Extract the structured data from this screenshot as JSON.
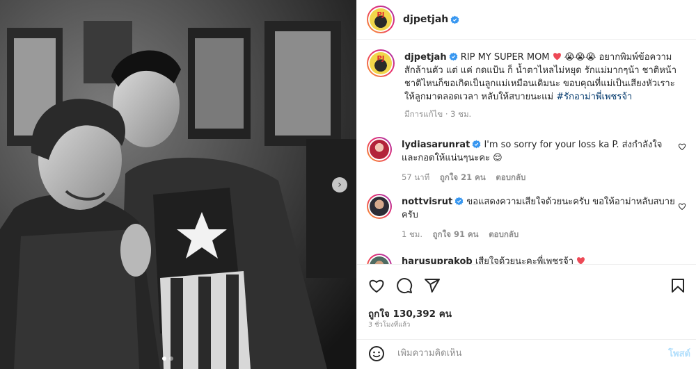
{
  "post": {
    "author": "djpetjah",
    "caption_parts": [
      "RIP MY SUPER MOM",
      "😭😭😭 อยากพิมพ์ข้อความสักล้านตัว แต่ แค่ กดแป้น ก็ น้ำตาไหลไม่หยุด รักแม่มากๆน้า ชาติหน้าชาติไหนก็ขอเกิดเป็นลูกแม่เหมือนเดิมนะ ขอบคุณที่แม่เป็นเสียงหัวเราะให้ลูกมาตลอดเวลา หลับให้สบายนะแม่"
    ],
    "hashtag": "#รักอาม่าพี่เพชรจ้า",
    "caption_meta": "มีการแก้ไข · 3 ชม."
  },
  "comments": [
    {
      "username": "lydiasarunrat",
      "text": "I'm so sorry for your loss ka P. ส่งกำลังใจและกอดให้แน่นๆนะคะ 😌",
      "time": "57 นาที",
      "likes": "ถูกใจ 21 คน",
      "reply": "ตอบกลับ"
    },
    {
      "username": "nottvisrut",
      "text": "ขอแสดงความเสียใจด้วยนะครับ ขอให้อาม่าหลับสบายครับ",
      "time": "1 ชม.",
      "likes": "ถูกใจ 91 คน",
      "reply": "ตอบกลับ"
    },
    {
      "username": "harusuprakob",
      "text": "เสียใจด้วยนะคะพี่เพชรจ้า"
    }
  ],
  "actions": {
    "likes": "ถูกใจ 130,392 คน",
    "time_ago": "3 ชั่วโมงที่แล้ว",
    "comment_placeholder": "เพิ่มความคิดเห็น",
    "post_label": "โพสต์"
  },
  "carousel": {
    "current": 1,
    "total": 2
  },
  "icons": {
    "verified": "verified-badge-icon",
    "heart": "heart-icon",
    "comment": "comment-icon",
    "share": "share-icon",
    "save": "bookmark-icon",
    "emoji": "emoji-icon",
    "next": "chevron-right-icon"
  },
  "colors": {
    "verified": "#3897f0",
    "heart_red": "#ed4956",
    "hashtag": "#00376b",
    "post_disabled": "#b2dffc"
  }
}
